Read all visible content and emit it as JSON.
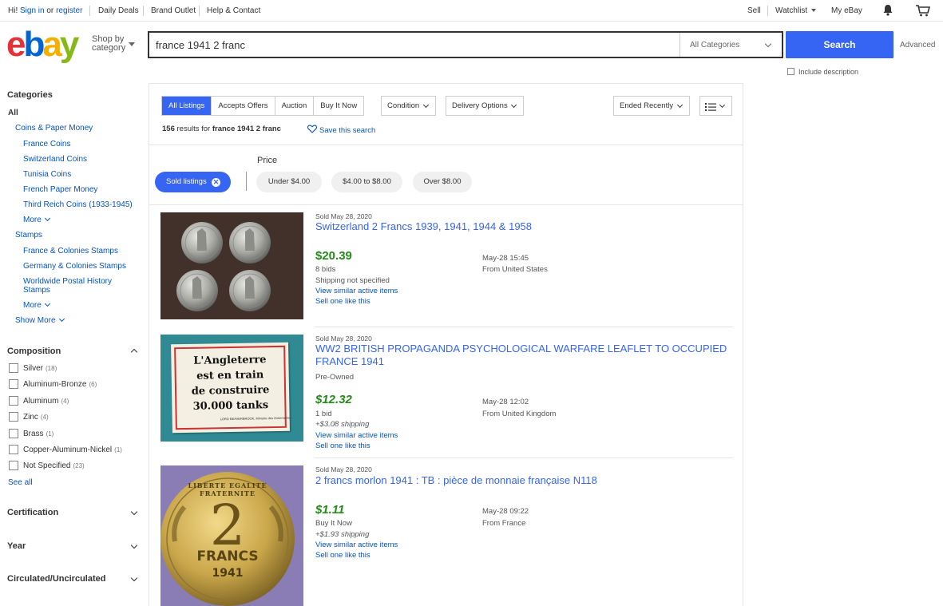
{
  "topbar": {
    "greeting_prefix": "Hi!",
    "sign_in": "Sign in",
    "or": "or",
    "register": "register",
    "daily_deals": "Daily Deals",
    "brand_outlet": "Brand Outlet",
    "help_contact": "Help & Contact",
    "sell": "Sell",
    "watchlist": "Watchlist",
    "my_ebay": "My eBay"
  },
  "header": {
    "logo_letters": [
      "e",
      "b",
      "a",
      "y"
    ],
    "logo_colors": [
      "#e53238",
      "#0064d2",
      "#f5af02",
      "#86b817"
    ],
    "shop_by_line1": "Shop by",
    "shop_by_line2": "category",
    "search_value": "france 1941 2 franc",
    "category_select": "All Categories",
    "search_button": "Search",
    "advanced": "Advanced",
    "include_description": "Include description"
  },
  "sidebar": {
    "categories_title": "Categories",
    "all": "All",
    "coins_paper_money": "Coins & Paper Money",
    "france_coins": "France Coins",
    "switzerland_coins": "Switzerland Coins",
    "tunisia_coins": "Tunisia Coins",
    "french_paper_money": "French Paper Money",
    "third_reich_coins": "Third Reich Coins (1933-1945)",
    "more_1": "More",
    "stamps": "Stamps",
    "france_colonies_stamps": "France & Colonies Stamps",
    "germany_colonies_stamps": "Germany & Colonies Stamps",
    "worldwide_postal_line1": "Worldwide Postal History",
    "worldwide_postal_line2": "Stamps",
    "more_2": "More",
    "show_more": "Show More",
    "composition_title": "Composition",
    "composition": [
      {
        "label": "Silver",
        "count": "(18)"
      },
      {
        "label": "Aluminum-Bronze",
        "count": "(6)"
      },
      {
        "label": "Aluminum",
        "count": "(4)"
      },
      {
        "label": "Zinc",
        "count": "(4)"
      },
      {
        "label": "Brass",
        "count": "(1)"
      },
      {
        "label": "Copper-Aluminum-Nickel",
        "count": "(1)"
      },
      {
        "label": "Not Specified",
        "count": "(23)"
      }
    ],
    "see_all": "See all",
    "certification": "Certification",
    "year": "Year",
    "circulated": "Circulated/Uncirculated"
  },
  "results": {
    "tabs": [
      "All Listings",
      "Accepts Offers",
      "Auction",
      "Buy It Now"
    ],
    "condition": "Condition",
    "delivery_options": "Delivery Options",
    "sort": "Ended Recently",
    "count": "156",
    "results_for": "results for",
    "query": "france 1941 2 franc",
    "save_search": "Save this search",
    "price_label": "Price",
    "sold_listings": "Sold listings",
    "price_pills": [
      "Under $4.00",
      "$4.00 to $8.00",
      "Over $8.00"
    ]
  },
  "listings": [
    {
      "sold_date": "Sold May 28, 2020",
      "title": "Switzerland 2 Francs 1939, 1941, 1944 & 1958",
      "condition": "",
      "price": "$20.39",
      "line1": "8 bids",
      "line2": "Shipping not specified",
      "similar": "View similar active items",
      "sell_one": "Sell one like this",
      "end_time": "May-28 15:45",
      "location": "From United States"
    },
    {
      "sold_date": "Sold May 28, 2020",
      "title": "WW2 BRITISH PROPAGANDA PSYCHOLOGICAL WARFARE LEAFLET TO OCCUPIED FRANCE 1941",
      "condition": "Pre-Owned",
      "price": "$12.32",
      "line1": "1 bid",
      "line2": "+$3.08 shipping",
      "similar": "View similar active items",
      "sell_one": "Sell one like this",
      "end_time": "May-28 12:02",
      "location": "From United Kingdom",
      "leaflet_lines": [
        "L'Angleterre",
        "est en train",
        "de construire",
        "30.000 tanks"
      ],
      "leaflet_signature": "LORD BEAVERBROOK, Ministre des Armements"
    },
    {
      "sold_date": "Sold May 28, 2020",
      "title": "2 francs morlon 1941 : TB : pièce de monnaie française N118",
      "condition": "",
      "price": "$1.11",
      "line1": "Buy It Now",
      "line2": "+$1.93 shipping",
      "similar": "View similar active items",
      "sell_one": "Sell one like this",
      "end_time": "May-28 09:22",
      "location": "From France",
      "coin_motto": "LIBERTE EGALITE FRATERNITE",
      "coin_value": "2",
      "coin_unit": "FRANCS",
      "coin_year": "1941"
    }
  ]
}
